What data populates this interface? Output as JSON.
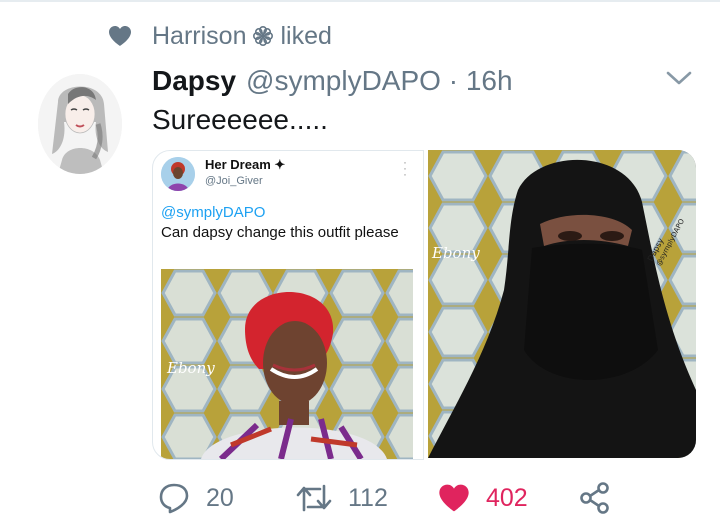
{
  "social_context": {
    "name": "Harrison",
    "action": "liked"
  },
  "tweet": {
    "display_name": "Dapsy",
    "handle": "@symplyDAPO",
    "separator": "·",
    "time": "16h",
    "text": "Sureeeeee....."
  },
  "quoted": {
    "display_name": "Her Dream",
    "handle": "@Joi_Giver",
    "mention": "@symplyDAPO",
    "text": "Can dapsy change this outfit please",
    "watermark": "Ebony"
  },
  "photo2": {
    "watermark": "Ebony",
    "credit_name": "Dapsy",
    "credit_handle": "@symplyDAPO"
  },
  "actions": {
    "replies": "20",
    "retweets": "112",
    "likes": "402"
  },
  "colors": {
    "like": "#e0245e",
    "muted": "#657786",
    "link": "#1da1f2",
    "background": "#ffffff"
  },
  "icons": [
    "heart-icon",
    "flower-icon",
    "chevron-down-icon",
    "reply-icon",
    "retweet-icon",
    "share-icon"
  ]
}
